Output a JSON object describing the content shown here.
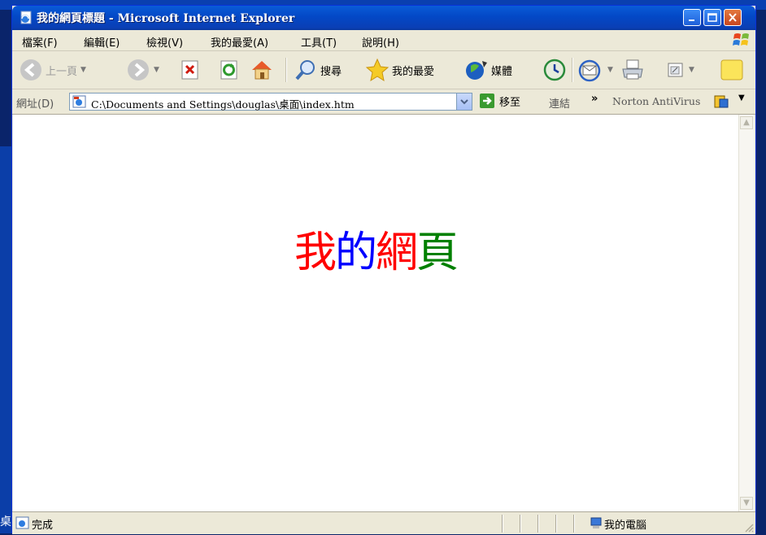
{
  "window": {
    "title": "我的網頁標題 - Microsoft Internet Explorer"
  },
  "menu": [
    "檔案(F)",
    "編輯(E)",
    "檢視(V)",
    "我的最愛(A)",
    "工具(T)",
    "說明(H)"
  ],
  "toolbar": {
    "back": "上一頁",
    "search": "搜尋",
    "favorites": "我的最愛",
    "media": "媒體"
  },
  "address": {
    "label": "網址(D)",
    "value": "C:\\Documents and Settings\\douglas\\桌面\\index.htm",
    "go": "移至",
    "links": "連結",
    "chevron": "»",
    "norton": "Norton AntiVirus"
  },
  "page": {
    "chars": [
      {
        "text": "我",
        "color": "#ff0000"
      },
      {
        "text": "的",
        "color": "#0000ff"
      },
      {
        "text": "網",
        "color": "#ff0000"
      },
      {
        "text": "頁",
        "color": "#008000"
      }
    ]
  },
  "status": {
    "text": "完成",
    "zone": "我的電腦"
  },
  "desktop": {
    "fragment": "桌"
  }
}
